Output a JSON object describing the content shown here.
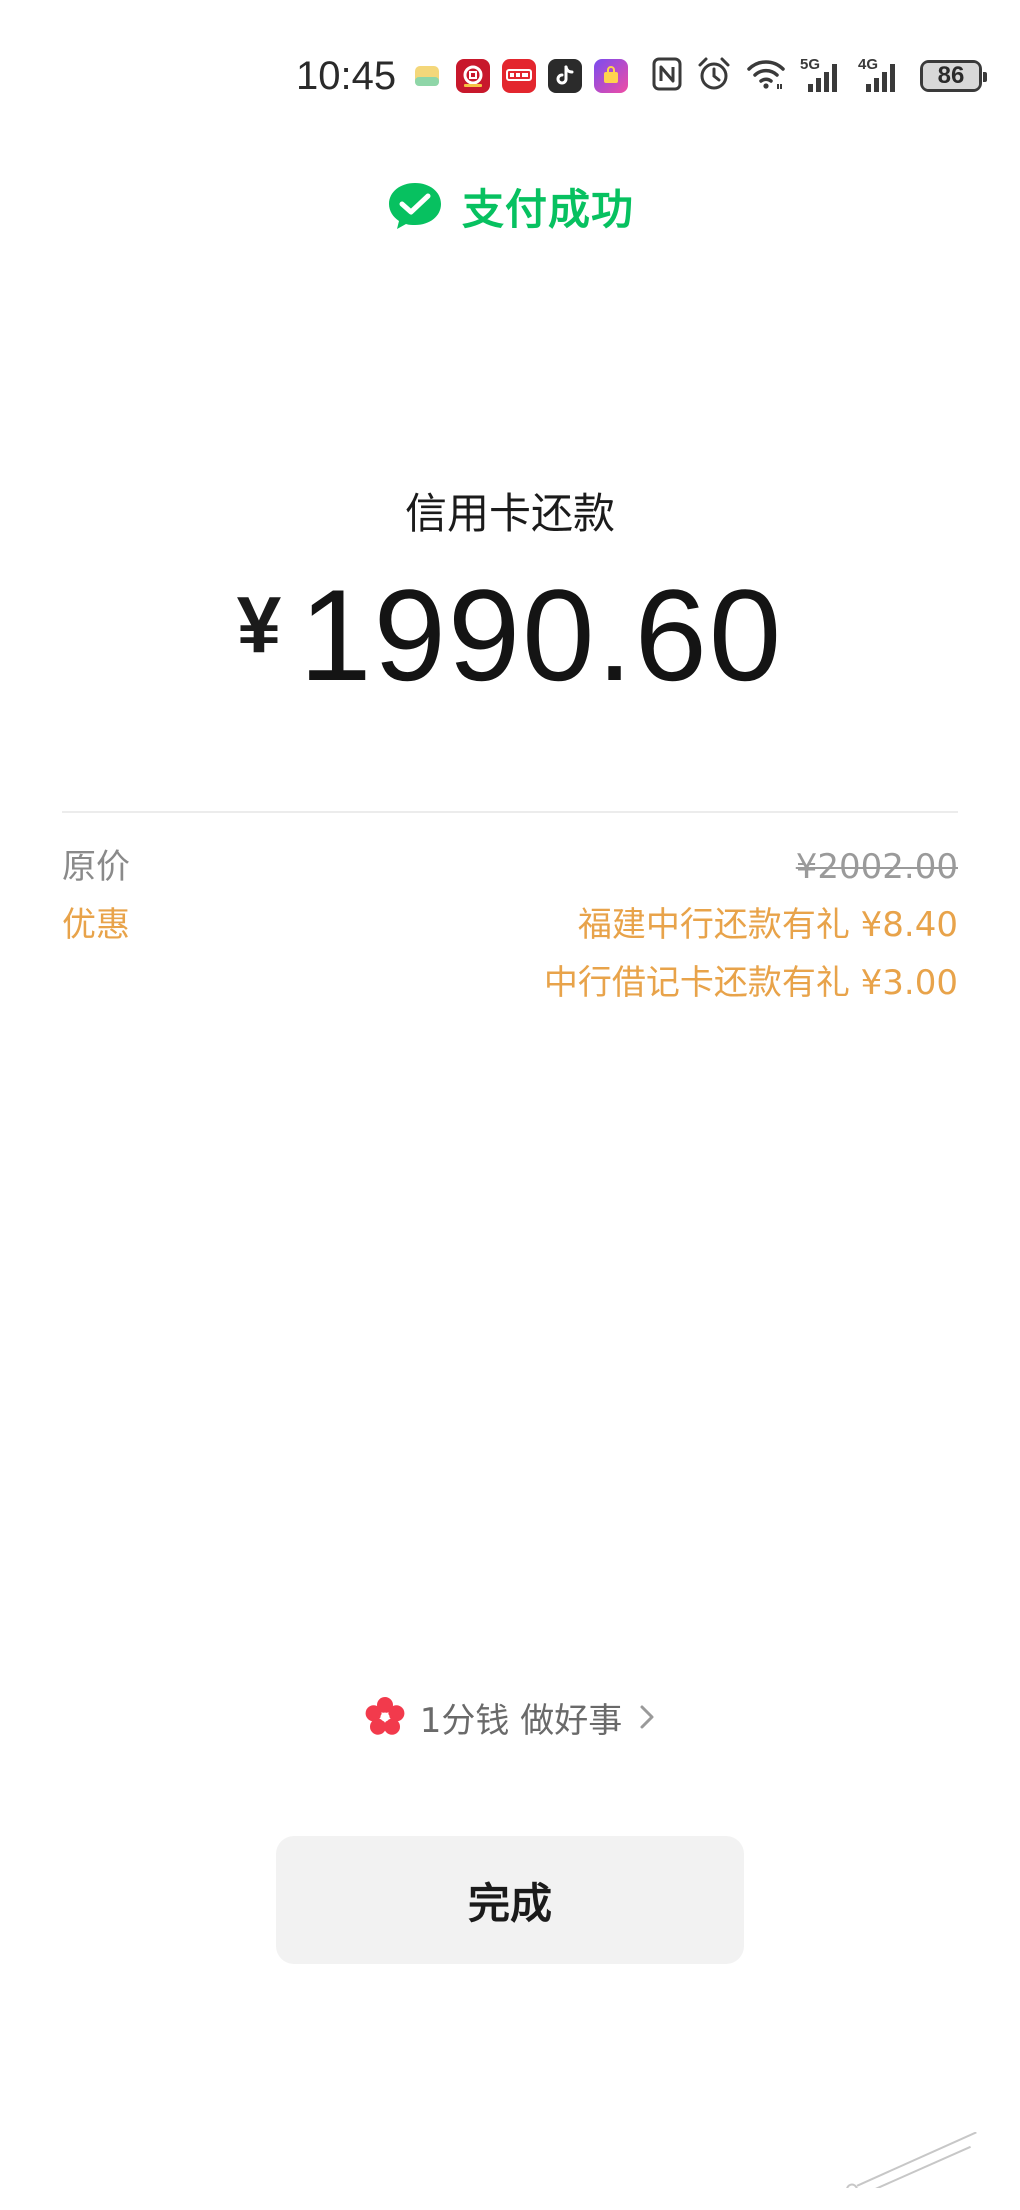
{
  "status_bar": {
    "time": "10:45",
    "battery_level": "86",
    "notification_icons": [
      "notes-app-icon",
      "bank-app-icon",
      "pay-app-icon",
      "tiktok-icon",
      "shopping-app-icon"
    ],
    "system_icons": [
      "nfc-icon",
      "alarm-icon",
      "wifi-icon",
      "signal-5g-icon",
      "signal-4g-icon",
      "battery-icon"
    ],
    "network_5g": "5G",
    "network_4g": "4G"
  },
  "header": {
    "title": "支付成功",
    "accent_color": "#07c160"
  },
  "payment": {
    "title": "信用卡还款",
    "currency": "¥",
    "amount": "1990.60"
  },
  "details": {
    "original_label": "原价",
    "original_value": "¥2002.00",
    "discount_label": "优惠",
    "discounts": [
      "福建中行还款有礼 ¥8.40",
      "中行借记卡还款有礼 ¥3.00"
    ],
    "discount_color": "#e8a34a"
  },
  "charity": {
    "text": "1分钱 做好事"
  },
  "actions": {
    "done_label": "完成"
  }
}
